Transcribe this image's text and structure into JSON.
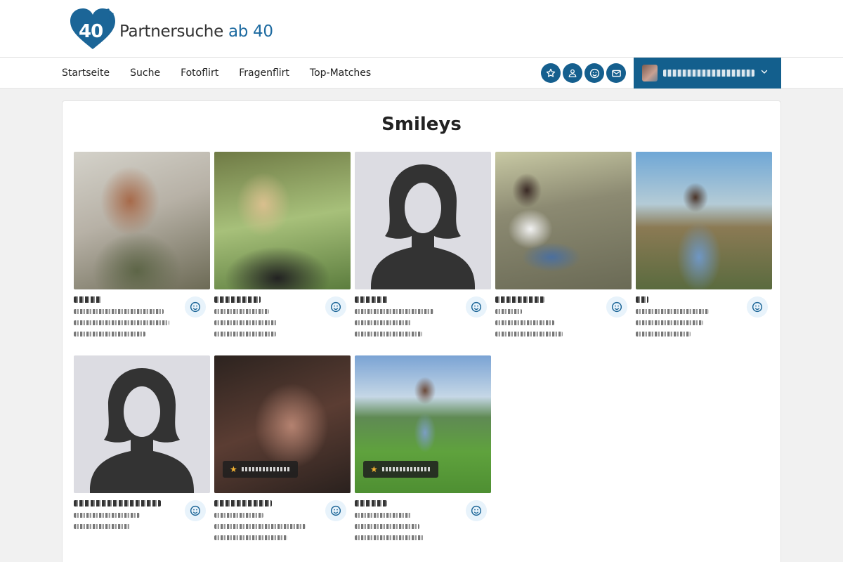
{
  "brand": {
    "logo_number": "40",
    "name_part1": "Partnersuche",
    "name_part2": "ab 40"
  },
  "nav": {
    "links": [
      "Startseite",
      "Suche",
      "Fotoflirt",
      "Fragenflirt",
      "Top-Matches"
    ],
    "icons": [
      "star-icon",
      "user-icon",
      "smiley-icon",
      "mail-icon"
    ]
  },
  "page": {
    "title": "Smileys"
  },
  "colors": {
    "brand_blue": "#135f8d",
    "accent_blue": "#1d6aa0",
    "background": "#f1f1f1"
  }
}
